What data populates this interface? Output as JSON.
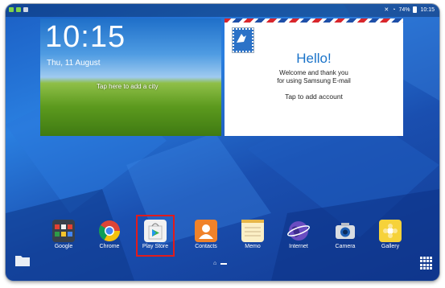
{
  "status": {
    "battery": "74%",
    "time": "10:15"
  },
  "clock_widget": {
    "time": "10:15",
    "date": "Thu, 11 August",
    "city_hint": "Tap here to add a city"
  },
  "email_widget": {
    "greeting": "Hello!",
    "line1": "Welcome and thank you",
    "line2": "for using Samsung E-mail",
    "action": "Tap to add account"
  },
  "dock": {
    "apps": [
      {
        "label": "Google",
        "icon": "google-folder-icon"
      },
      {
        "label": "Chrome",
        "icon": "chrome-icon"
      },
      {
        "label": "Play Store",
        "icon": "play-store-icon"
      },
      {
        "label": "Contacts",
        "icon": "contacts-icon"
      },
      {
        "label": "Memo",
        "icon": "memo-icon"
      },
      {
        "label": "Internet",
        "icon": "internet-icon"
      },
      {
        "label": "Camera",
        "icon": "camera-icon"
      },
      {
        "label": "Gallery",
        "icon": "gallery-icon"
      }
    ]
  },
  "colors": {
    "highlight": "#e21b1b",
    "wallpaper": "#1b5fc4",
    "email_accent": "#1a73c9"
  }
}
